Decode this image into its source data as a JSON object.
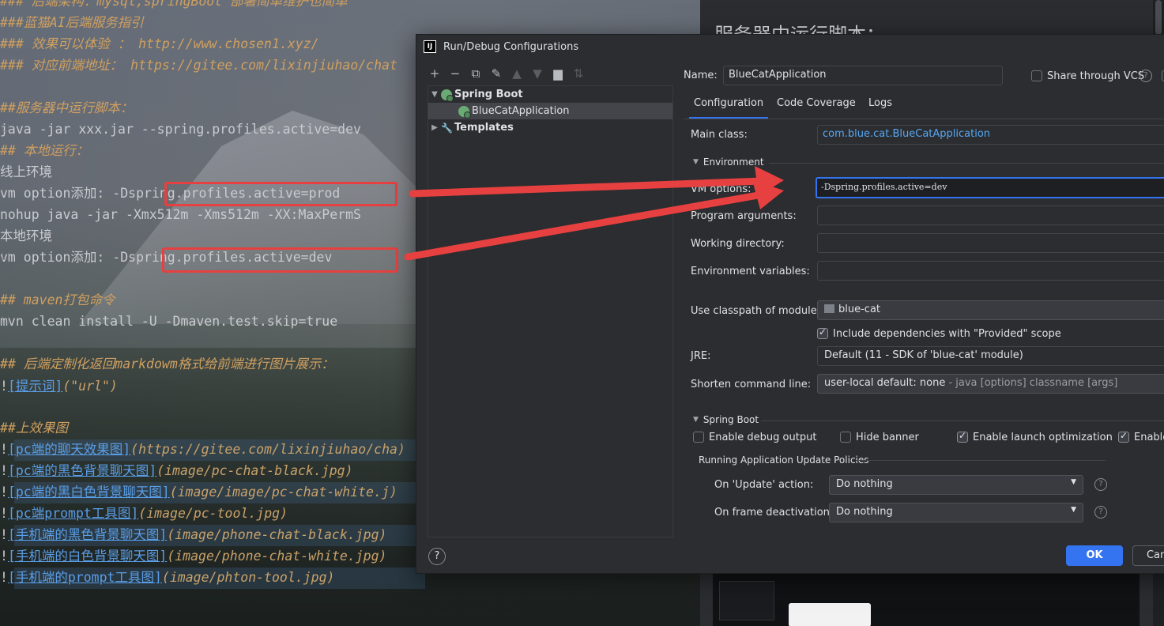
{
  "editor": {
    "lines": [
      {
        "kind": "h",
        "text": "### 后端架构：mysql,springBoot 部署简单维护也简单"
      },
      {
        "kind": "h",
        "text": " ###蓝猫AI后端服务指引"
      },
      {
        "kind": "h",
        "text": "### 效果可以体验 ： http://www.chosen1.xyz/"
      },
      {
        "kind": "h",
        "text": "### 对应前端地址： https://gitee.com/lixinjiuhao/chat"
      },
      {
        "kind": "blank",
        "text": ""
      },
      {
        "kind": "h",
        "text": " ##服务器中运行脚本："
      },
      {
        "kind": "plain",
        "text": "    java -jar xxx.jar --spring.profiles.active=dev"
      },
      {
        "kind": "h",
        "text": " ## 本地运行："
      },
      {
        "kind": "plain",
        "text": "     线上环境"
      },
      {
        "kind": "plain",
        "text": "     vm option添加: -Dspring.profiles.active=prod"
      },
      {
        "kind": "plain",
        "text": "     nohup java -jar -Xmx512m -Xms512m -XX:MaxPermS"
      },
      {
        "kind": "plain",
        "text": "     本地环境"
      },
      {
        "kind": "plain",
        "text": "     vm option添加: -Dspring.profiles.active=dev"
      },
      {
        "kind": "blank",
        "text": ""
      },
      {
        "kind": "h",
        "text": "## maven打包命令"
      },
      {
        "kind": "plain",
        "text": "    mvn clean install -U -Dmaven.test.skip=true"
      },
      {
        "kind": "blank",
        "text": ""
      },
      {
        "kind": "h",
        "text": "## 后端定制化返回markdowm格式给前端进行图片展示："
      }
    ],
    "image_links": [
      {
        "label": "提示词",
        "target": "\"url\""
      },
      {
        "label": "",
        "target": ""
      },
      {
        "label": "",
        "target": ""
      },
      {
        "label": "pc端的聊天效果图",
        "target": "https://gitee.com/lixinjiuhao/cha"
      },
      {
        "label": "pc端的黑色背景聊天图",
        "target": "image/pc-chat-black.jpg"
      },
      {
        "label": "pc端的黑白色背景聊天图",
        "target": "image/image/pc-chat-white.j"
      },
      {
        "label": "pc端prompt工具图",
        "target": "image/pc-tool.jpg"
      },
      {
        "label": "手机端的黑色背景聊天图",
        "target": "image/phone-chat-black.jpg"
      },
      {
        "label": "手机端的白色背景聊天图",
        "target": "image/phone-chat-white.jpg"
      },
      {
        "label": "手机端的prompt工具图",
        "target": "image/phton-tool.jpg"
      }
    ],
    "effect_heading": "##上效果图"
  },
  "right_pane": {
    "doc_title": "服务器中运行脚本："
  },
  "dialog": {
    "title": "Run/Debug Configurations",
    "logo": "IJ",
    "toolbar_icons": [
      "add-icon",
      "remove-icon",
      "copy-icon",
      "wrench-icon",
      "move-up-icon",
      "move-down-icon",
      "new-folder-icon",
      "sort-icon"
    ],
    "tree": {
      "spring_boot": "Spring Boot",
      "app": "BlueCatApplication",
      "templates": "Templates"
    },
    "name_label": "Name:",
    "name_value": "BlueCatApplication",
    "share_vcs": "Share through VCS",
    "tabs": [
      "Configuration",
      "Code Coverage",
      "Logs"
    ],
    "main_class_label": "Main class:",
    "main_class_value": "com.blue.cat.BlueCatApplication",
    "environment_label": "Environment",
    "vm_options_label": "VM options:",
    "vm_options_value": "-Dspring.profiles.active=dev",
    "program_args_label": "Program arguments:",
    "working_dir_label": "Working directory:",
    "env_vars_label": "Environment variables:",
    "classpath_label": "Use classpath of module:",
    "classpath_value": "blue-cat",
    "include_deps": "Include dependencies with \"Provided\" scope",
    "jre_label": "JRE:",
    "jre_value": "Default (11 - SDK of 'blue-cat' module)",
    "shorten_label": "Shorten command line:",
    "shorten_value": "user-local default: none",
    "shorten_hint": " - java [options] classname [args]",
    "spring_boot_section": "Spring Boot",
    "enable_debug": "Enable debug output",
    "hide_banner": "Hide banner",
    "enable_launch": "Enable launch optimization",
    "enable_partial": "Enable",
    "update_policies": "Running Application Update Policies",
    "on_update_label": "On 'Update' action:",
    "on_update_value": "Do nothing",
    "on_frame_label": "On frame deactivation:",
    "on_frame_value": "Do nothing",
    "ok": "OK",
    "cancel": "Cancel",
    "help": "?"
  },
  "colors": {
    "accent": "#3574f0",
    "annotation_red": "#e74040",
    "heading": "#d0a060",
    "link": "#5a9ee8"
  }
}
